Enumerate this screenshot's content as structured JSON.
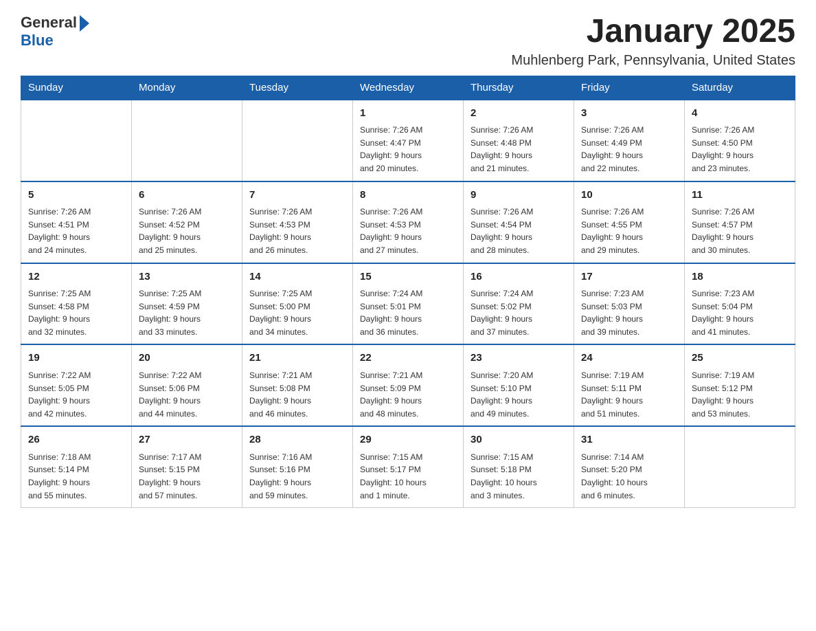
{
  "header": {
    "logo": {
      "general": "General",
      "blue": "Blue"
    },
    "title": "January 2025",
    "subtitle": "Muhlenberg Park, Pennsylvania, United States"
  },
  "weekdays": [
    "Sunday",
    "Monday",
    "Tuesday",
    "Wednesday",
    "Thursday",
    "Friday",
    "Saturday"
  ],
  "weeks": [
    [
      {
        "day": "",
        "info": ""
      },
      {
        "day": "",
        "info": ""
      },
      {
        "day": "",
        "info": ""
      },
      {
        "day": "1",
        "info": "Sunrise: 7:26 AM\nSunset: 4:47 PM\nDaylight: 9 hours\nand 20 minutes."
      },
      {
        "day": "2",
        "info": "Sunrise: 7:26 AM\nSunset: 4:48 PM\nDaylight: 9 hours\nand 21 minutes."
      },
      {
        "day": "3",
        "info": "Sunrise: 7:26 AM\nSunset: 4:49 PM\nDaylight: 9 hours\nand 22 minutes."
      },
      {
        "day": "4",
        "info": "Sunrise: 7:26 AM\nSunset: 4:50 PM\nDaylight: 9 hours\nand 23 minutes."
      }
    ],
    [
      {
        "day": "5",
        "info": "Sunrise: 7:26 AM\nSunset: 4:51 PM\nDaylight: 9 hours\nand 24 minutes."
      },
      {
        "day": "6",
        "info": "Sunrise: 7:26 AM\nSunset: 4:52 PM\nDaylight: 9 hours\nand 25 minutes."
      },
      {
        "day": "7",
        "info": "Sunrise: 7:26 AM\nSunset: 4:53 PM\nDaylight: 9 hours\nand 26 minutes."
      },
      {
        "day": "8",
        "info": "Sunrise: 7:26 AM\nSunset: 4:53 PM\nDaylight: 9 hours\nand 27 minutes."
      },
      {
        "day": "9",
        "info": "Sunrise: 7:26 AM\nSunset: 4:54 PM\nDaylight: 9 hours\nand 28 minutes."
      },
      {
        "day": "10",
        "info": "Sunrise: 7:26 AM\nSunset: 4:55 PM\nDaylight: 9 hours\nand 29 minutes."
      },
      {
        "day": "11",
        "info": "Sunrise: 7:26 AM\nSunset: 4:57 PM\nDaylight: 9 hours\nand 30 minutes."
      }
    ],
    [
      {
        "day": "12",
        "info": "Sunrise: 7:25 AM\nSunset: 4:58 PM\nDaylight: 9 hours\nand 32 minutes."
      },
      {
        "day": "13",
        "info": "Sunrise: 7:25 AM\nSunset: 4:59 PM\nDaylight: 9 hours\nand 33 minutes."
      },
      {
        "day": "14",
        "info": "Sunrise: 7:25 AM\nSunset: 5:00 PM\nDaylight: 9 hours\nand 34 minutes."
      },
      {
        "day": "15",
        "info": "Sunrise: 7:24 AM\nSunset: 5:01 PM\nDaylight: 9 hours\nand 36 minutes."
      },
      {
        "day": "16",
        "info": "Sunrise: 7:24 AM\nSunset: 5:02 PM\nDaylight: 9 hours\nand 37 minutes."
      },
      {
        "day": "17",
        "info": "Sunrise: 7:23 AM\nSunset: 5:03 PM\nDaylight: 9 hours\nand 39 minutes."
      },
      {
        "day": "18",
        "info": "Sunrise: 7:23 AM\nSunset: 5:04 PM\nDaylight: 9 hours\nand 41 minutes."
      }
    ],
    [
      {
        "day": "19",
        "info": "Sunrise: 7:22 AM\nSunset: 5:05 PM\nDaylight: 9 hours\nand 42 minutes."
      },
      {
        "day": "20",
        "info": "Sunrise: 7:22 AM\nSunset: 5:06 PM\nDaylight: 9 hours\nand 44 minutes."
      },
      {
        "day": "21",
        "info": "Sunrise: 7:21 AM\nSunset: 5:08 PM\nDaylight: 9 hours\nand 46 minutes."
      },
      {
        "day": "22",
        "info": "Sunrise: 7:21 AM\nSunset: 5:09 PM\nDaylight: 9 hours\nand 48 minutes."
      },
      {
        "day": "23",
        "info": "Sunrise: 7:20 AM\nSunset: 5:10 PM\nDaylight: 9 hours\nand 49 minutes."
      },
      {
        "day": "24",
        "info": "Sunrise: 7:19 AM\nSunset: 5:11 PM\nDaylight: 9 hours\nand 51 minutes."
      },
      {
        "day": "25",
        "info": "Sunrise: 7:19 AM\nSunset: 5:12 PM\nDaylight: 9 hours\nand 53 minutes."
      }
    ],
    [
      {
        "day": "26",
        "info": "Sunrise: 7:18 AM\nSunset: 5:14 PM\nDaylight: 9 hours\nand 55 minutes."
      },
      {
        "day": "27",
        "info": "Sunrise: 7:17 AM\nSunset: 5:15 PM\nDaylight: 9 hours\nand 57 minutes."
      },
      {
        "day": "28",
        "info": "Sunrise: 7:16 AM\nSunset: 5:16 PM\nDaylight: 9 hours\nand 59 minutes."
      },
      {
        "day": "29",
        "info": "Sunrise: 7:15 AM\nSunset: 5:17 PM\nDaylight: 10 hours\nand 1 minute."
      },
      {
        "day": "30",
        "info": "Sunrise: 7:15 AM\nSunset: 5:18 PM\nDaylight: 10 hours\nand 3 minutes."
      },
      {
        "day": "31",
        "info": "Sunrise: 7:14 AM\nSunset: 5:20 PM\nDaylight: 10 hours\nand 6 minutes."
      },
      {
        "day": "",
        "info": ""
      }
    ]
  ]
}
